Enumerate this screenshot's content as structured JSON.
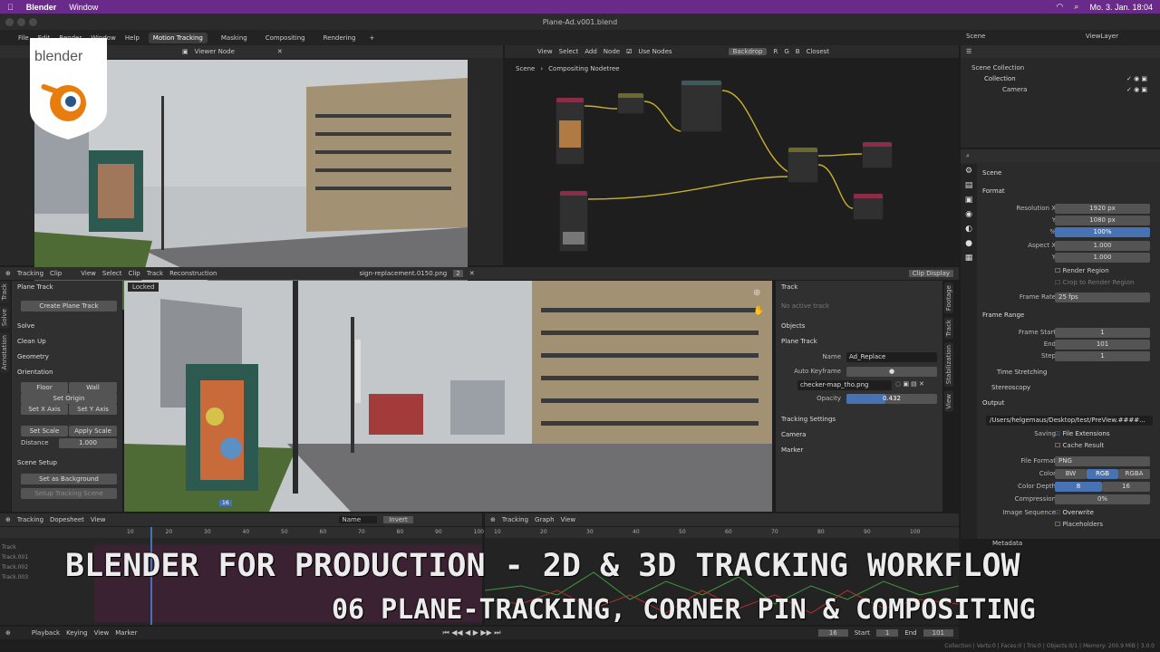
{
  "macbar": {
    "app": "Blender",
    "menu": "Window",
    "datetime": "Mo. 3. Jan.  18:04"
  },
  "window": {
    "title": "Plane-Ad.v001.blend"
  },
  "menubar": {
    "items": [
      "File",
      "Edit",
      "Render",
      "Window",
      "Help"
    ],
    "workspaces": [
      "Motion Tracking",
      "Masking",
      "Compositing",
      "Rendering"
    ],
    "add_tab": "+"
  },
  "logo": {
    "text": "blender"
  },
  "viewer": {
    "header_label": "Viewer Node"
  },
  "compositor": {
    "menus": [
      "View",
      "Select",
      "Add",
      "Node"
    ],
    "use_nodes": "Use Nodes",
    "backdrop": "Backdrop",
    "channels": [
      "R",
      "G",
      "B"
    ],
    "filter": "Closest",
    "breadcrumb_scene": "Scene",
    "breadcrumb_tree": "Compositing Nodetree"
  },
  "clip_editor": {
    "mode": "Tracking",
    "view": "Clip",
    "menus": [
      "View",
      "Select",
      "Clip",
      "Track",
      "Reconstruction"
    ],
    "clip_name": "sign-replacement.0150.png",
    "users": "2",
    "display": "Clip Display",
    "locked": "Locked",
    "frame_marker": "16"
  },
  "toolbar_left": {
    "plane_track": "Plane Track",
    "create_plane_track": "Create Plane Track",
    "solve": "Solve",
    "clean_up": "Clean Up",
    "geometry": "Geometry",
    "orientation": "Orientation",
    "floor": "Floor",
    "wall": "Wall",
    "set_origin": "Set Origin",
    "set_x_axis": "Set X Axis",
    "set_y_axis": "Set Y Axis",
    "set_scale": "Set Scale",
    "apply_scale": "Apply Scale",
    "distance_label": "Distance",
    "distance_value": "1.000",
    "scene_setup": "Scene Setup",
    "set_as_background": "Set as Background",
    "setup_tracking_scene": "Setup Tracking Scene",
    "tabs": [
      "Track",
      "Solve",
      "Annotation"
    ]
  },
  "sidebar_right": {
    "track": "Track",
    "no_active_track": "No active track",
    "objects": "Objects",
    "plane_track": "Plane Track",
    "name_label": "Name",
    "name_value": "Ad_Replace",
    "auto_keyframe": "Auto Keyframe",
    "image": "checker-map_tho.png",
    "opacity_label": "Opacity",
    "opacity_value": "0.432",
    "opacity": 0.432,
    "tracking_settings": "Tracking Settings",
    "camera": "Camera",
    "marker": "Marker",
    "tabs": [
      "Footage",
      "Track",
      "Stabilization",
      "View"
    ]
  },
  "outliner": {
    "scene": "Scene",
    "view_layer": "ViewLayer",
    "scene_collection": "Scene Collection",
    "collection": "Collection",
    "camera": "Camera"
  },
  "properties": {
    "scene": "Scene",
    "format": "Format",
    "res_x_label": "Resolution X",
    "res_x": "1920 px",
    "y_label": "Y",
    "res_y": "1080 px",
    "pct_label": "%",
    "pct": "100%",
    "aspect_x_label": "Aspect X",
    "aspect_x": "1.000",
    "aspect_y": "1.000",
    "render_region": "Render Region",
    "crop_region": "Crop to Render Region",
    "frame_rate_label": "Frame Rate",
    "frame_rate": "25 fps",
    "frame_range": "Frame Range",
    "frame_start_label": "Frame Start",
    "frame_start": "1",
    "end_label": "End",
    "frame_end": "101",
    "step_label": "Step",
    "step": "1",
    "time_stretching": "Time Stretching",
    "stereoscopy": "Stereoscopy",
    "output": "Output",
    "output_path": "/Users/helgemaus/Desktop/test/PreView.####...",
    "saving_label": "Saving",
    "file_extensions": "File Extensions",
    "cache_result": "Cache Result",
    "file_format_label": "File Format",
    "file_format": "PNG",
    "color_label": "Color",
    "color_opts": [
      "BW",
      "RGB",
      "RGBA"
    ],
    "color_depth_label": "Color Depth",
    "depth_8": "8",
    "depth_16": "16",
    "compression_label": "Compression",
    "compression": "0%",
    "image_sequence_label": "Image Sequence",
    "overwrite": "Overwrite",
    "placeholders": "Placeholders",
    "metadata": "Metadata"
  },
  "dopesheet": {
    "mode": "Tracking",
    "view": "Dopesheet",
    "menu_view": "View",
    "sort": "Name",
    "invert": "Invert",
    "tracks": [
      "Track",
      "Track.001",
      "Track.002",
      "Track.003"
    ],
    "ticks": [
      "10",
      "20",
      "30",
      "40",
      "50",
      "60",
      "70",
      "80",
      "90",
      "100"
    ]
  },
  "graph": {
    "mode": "Tracking",
    "view": "Graph",
    "menu_view": "View",
    "ticks": [
      "10",
      "20",
      "30",
      "40",
      "50",
      "60",
      "70",
      "80",
      "90",
      "100"
    ]
  },
  "timeline": {
    "playback": "Playback",
    "keying": "Keying",
    "view": "View",
    "marker": "Marker",
    "current": "16",
    "start_label": "Start",
    "start": "1",
    "end_label": "End",
    "end": "101"
  },
  "status_bar": "Collection | Verts:0 | Faces:0 | Tris:0 | Objects:0/1 | Memory: 200.9 MiB | 3.0.0",
  "overlay": {
    "title": "BLENDER FOR PRODUCTION - 2D & 3D TRACKING WORKFLOW",
    "subtitle": "06 PLANE-TRACKING, CORNER PIN & COMPOSITING"
  },
  "colors": {
    "accent": "#4772b3",
    "macbar": "#6a2a8a",
    "node_wire": "#c9b02c"
  }
}
